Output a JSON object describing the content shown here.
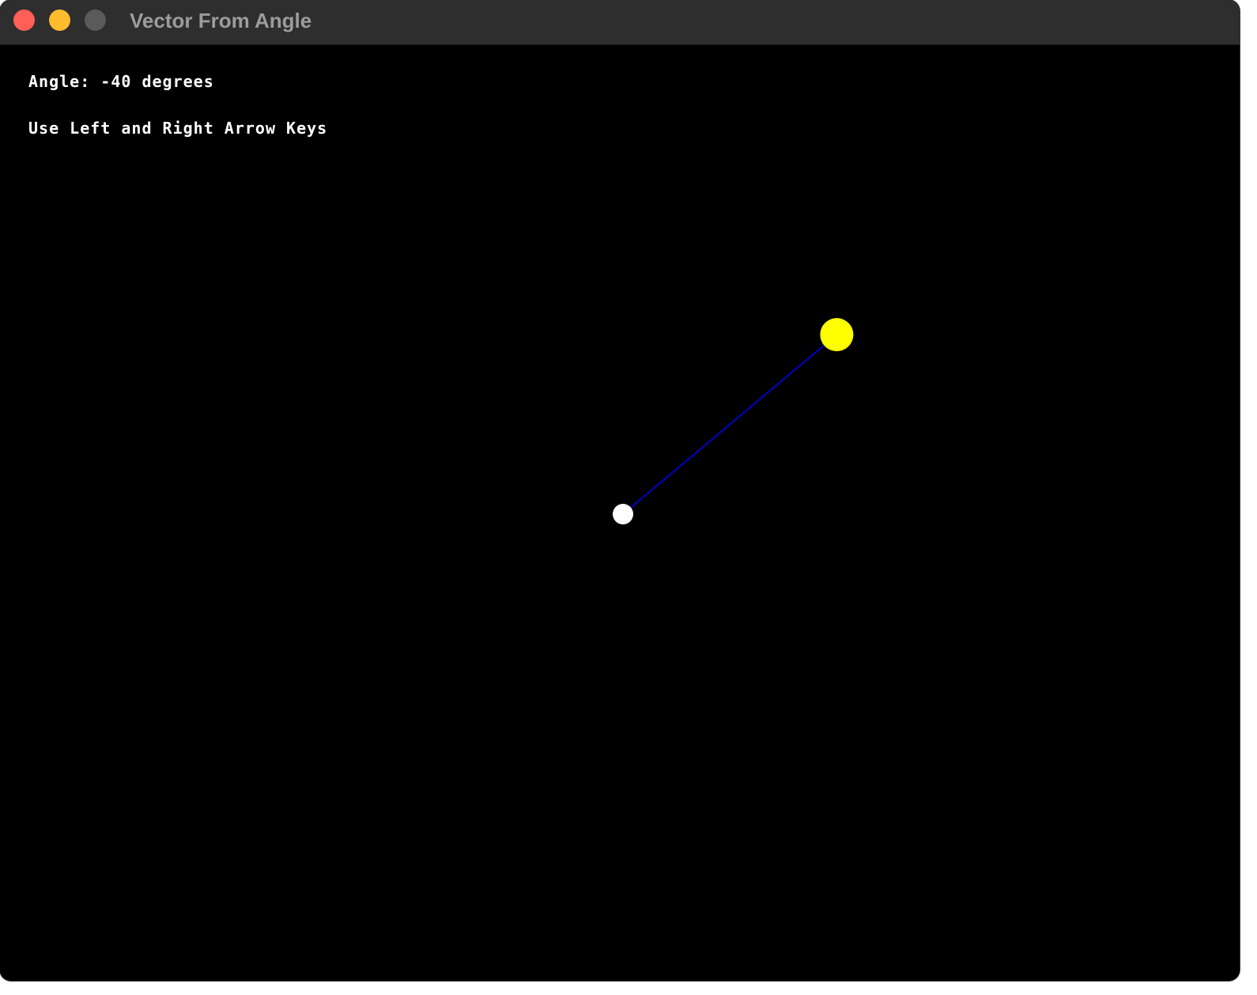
{
  "window": {
    "title": "Vector From Angle",
    "controls": {
      "close_color": "#ff5f57",
      "minimize_color": "#febc2e",
      "zoom_color": "#5a5a5a"
    }
  },
  "hud": {
    "angle_label": "Angle:",
    "angle_value": "-40",
    "angle_unit": "degrees",
    "instructions": "Use Left and Right Arrow Keys"
  },
  "scene": {
    "background": "#000000",
    "angle_degrees": -40,
    "origin_color": "#ffffff",
    "vector_color": "#0000c8",
    "tip_color": "#ffff00"
  }
}
